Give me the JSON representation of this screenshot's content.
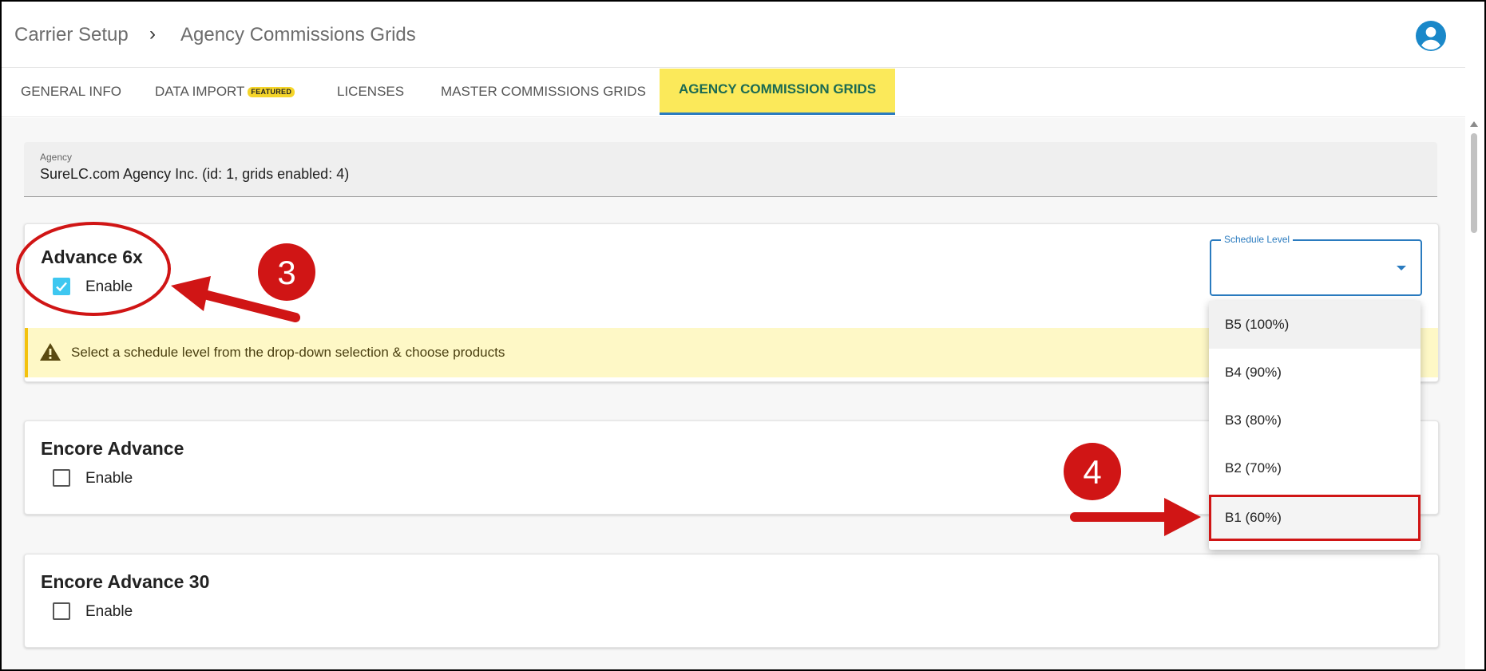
{
  "breadcrumb": {
    "root": "Carrier Setup",
    "separator": "›",
    "current": "Agency Commissions Grids"
  },
  "icons": {
    "avatar": "account-circle-icon",
    "warning": "warning-triangle-icon",
    "caret": "chevron-down-icon",
    "check": "check-icon"
  },
  "tabs": [
    {
      "label": "GENERAL INFO"
    },
    {
      "label": "DATA IMPORT",
      "badge": "FEATURED"
    },
    {
      "label": "LICENSES"
    },
    {
      "label": "MASTER COMMISSIONS GRIDS"
    },
    {
      "label": "AGENCY COMMISSION GRIDS",
      "active": true
    }
  ],
  "agency": {
    "label": "Agency",
    "value": "SureLC.com Agency Inc. (id: 1, grids enabled: 4)"
  },
  "cards": [
    {
      "title": "Advance 6x",
      "enable_label": "Enable",
      "checked": true
    },
    {
      "title": "Encore Advance",
      "enable_label": "Enable",
      "checked": false
    },
    {
      "title": "Encore Advance 30",
      "enable_label": "Enable",
      "checked": false
    }
  ],
  "warning": {
    "text": "Select a schedule level from the drop-down selection & choose products"
  },
  "schedule_select": {
    "label": "Schedule Level",
    "value": "",
    "options": [
      "B5 (100%)",
      "B4 (90%)",
      "B3 (80%)",
      "B2 (70%)",
      "B1 (60%)"
    ],
    "highlighted_option": "B1 (60%)"
  },
  "annotations": {
    "step_3": "3",
    "step_4": "4"
  },
  "colors": {
    "active_tab_bg": "#fbe95a",
    "active_tab_text": "#1b6a52",
    "accent_blue": "#2a7bbf",
    "checkbox_checked": "#3ec7f0",
    "warning_bg": "#fef8c6",
    "annotation_red": "#d01515"
  }
}
